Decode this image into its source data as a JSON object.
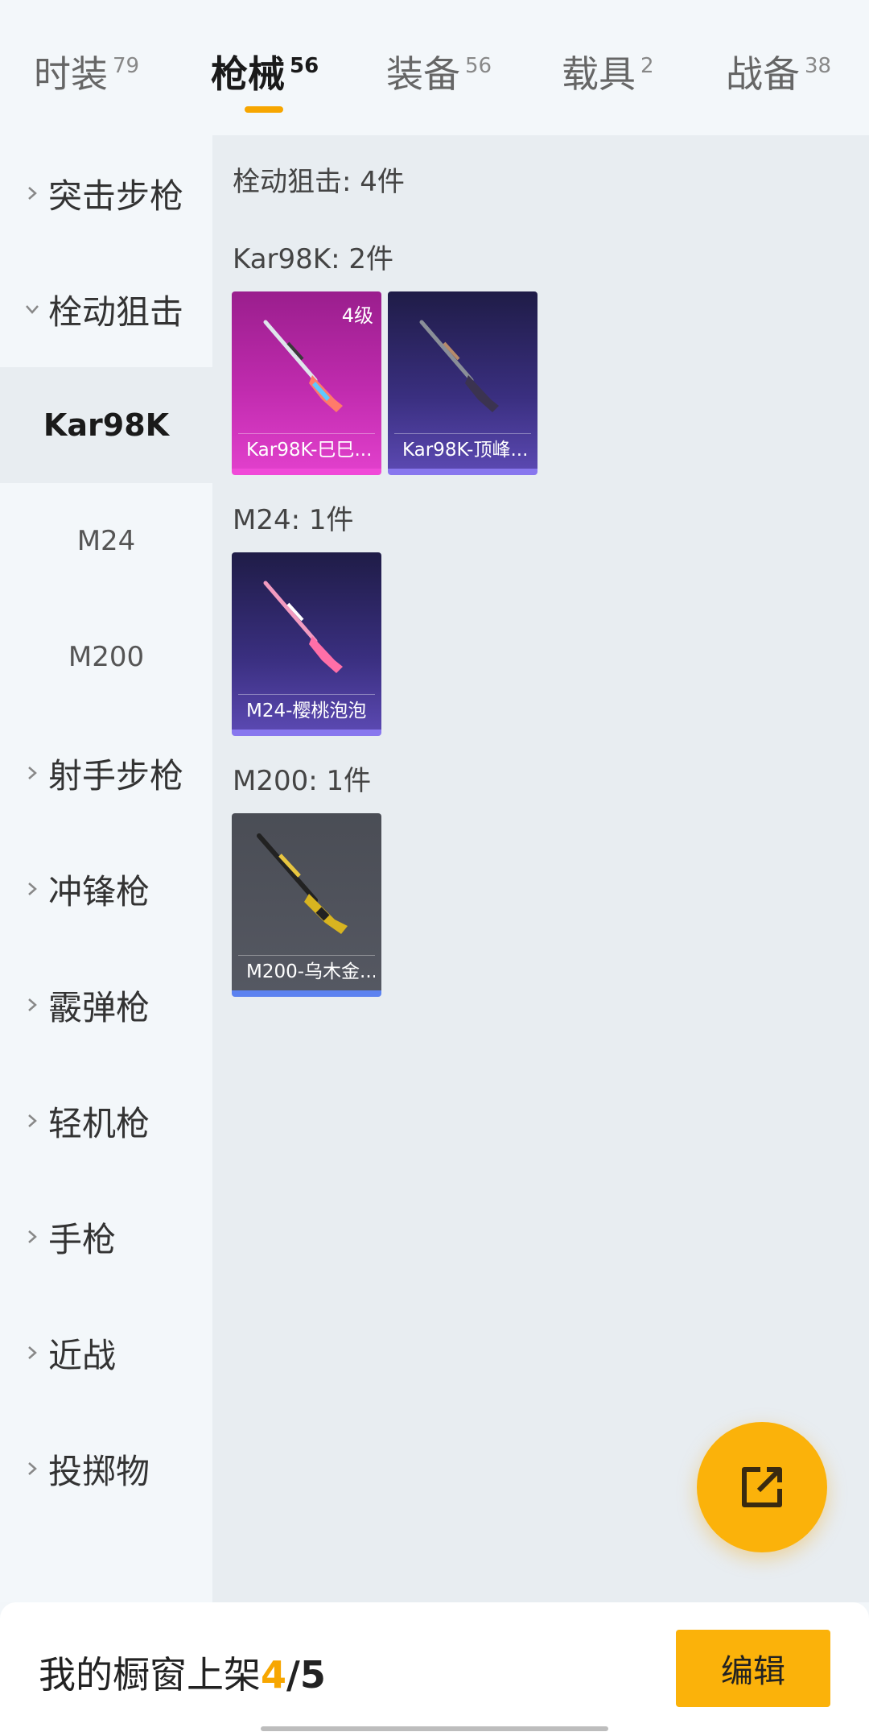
{
  "tabs": [
    {
      "label": "时装",
      "count": "79"
    },
    {
      "label": "枪械",
      "count": "56"
    },
    {
      "label": "装备",
      "count": "56"
    },
    {
      "label": "载具",
      "count": "2"
    },
    {
      "label": "战备",
      "count": "38"
    }
  ],
  "active_tab": "枪械",
  "sidebar": {
    "items": [
      {
        "label": "突击步枪"
      },
      {
        "label": "栓动狙击"
      },
      {
        "label": "Kar98K"
      },
      {
        "label": "M24"
      },
      {
        "label": "M200"
      },
      {
        "label": "射手步枪"
      },
      {
        "label": "冲锋枪"
      },
      {
        "label": "霰弹枪"
      },
      {
        "label": "轻机枪"
      },
      {
        "label": "手枪"
      },
      {
        "label": "近战"
      },
      {
        "label": "投掷物"
      }
    ]
  },
  "content": {
    "category_heading": "栓动狙击: 4件",
    "groups": [
      {
        "heading": "Kar98K: 2件",
        "items": [
          {
            "name": "Kar98K-巳巳...",
            "level": "4级"
          },
          {
            "name": "Kar98K-顶峰..."
          }
        ]
      },
      {
        "heading": "M24: 1件",
        "items": [
          {
            "name": "M24-樱桃泡泡"
          }
        ]
      },
      {
        "heading": "M200: 1件",
        "items": [
          {
            "name": "M200-乌木金..."
          }
        ]
      }
    ]
  },
  "fab": {
    "icon": "share-external-icon"
  },
  "bottom": {
    "showcase_label": "我的橱窗上架",
    "current": "4",
    "separator": "/",
    "total": "5",
    "edit_label": "编辑"
  },
  "colors": {
    "accent": "#fbb20a",
    "accent_text": "#f7a600",
    "card_pink": "#c02bae",
    "card_purple": "#3a2f80",
    "card_gray": "#4a4d55"
  }
}
